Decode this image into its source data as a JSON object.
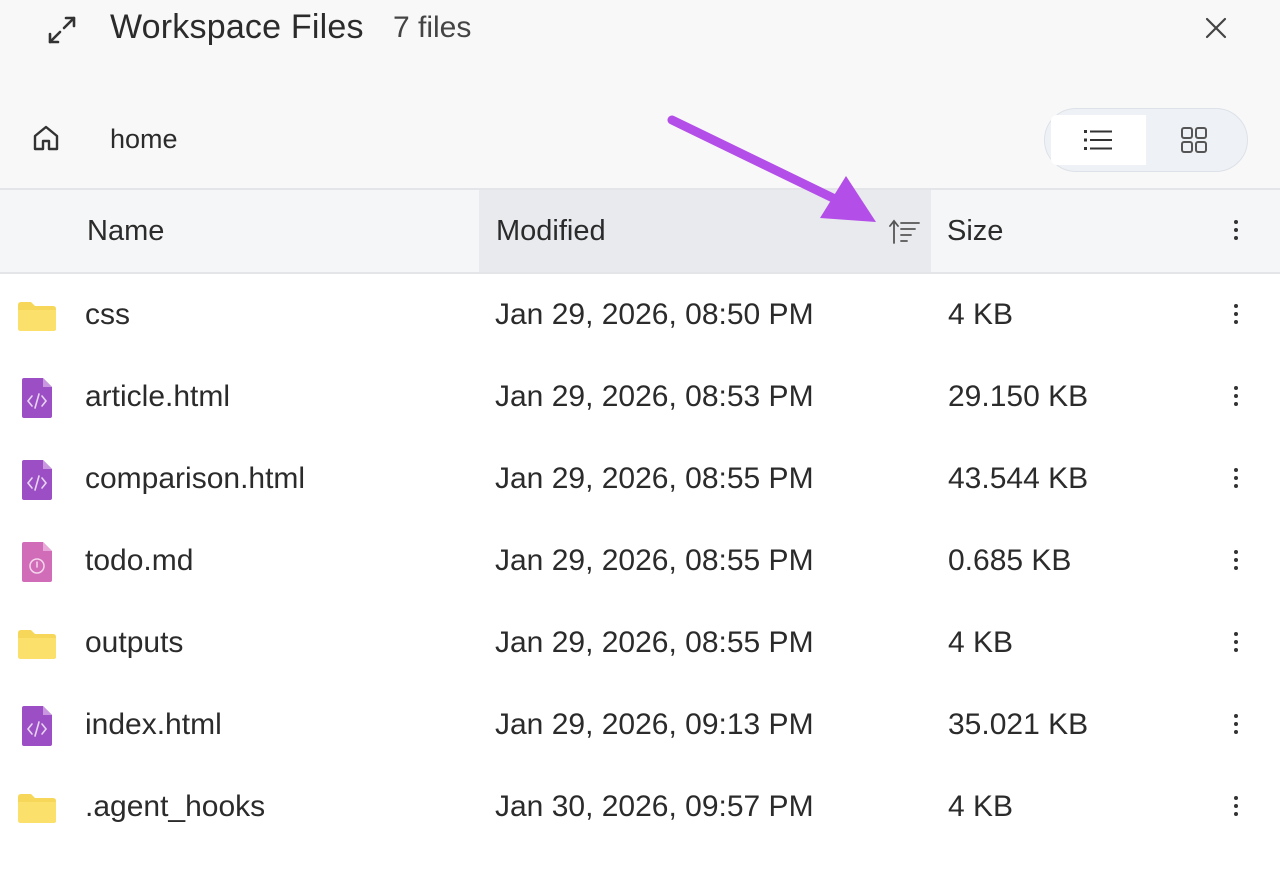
{
  "header": {
    "title": "Workspace Files",
    "count": "7 files"
  },
  "breadcrumb": {
    "current": "home"
  },
  "view_toggle": {
    "selected": "list"
  },
  "columns": {
    "name": "Name",
    "modified": "Modified",
    "size": "Size"
  },
  "sort": {
    "column": "Modified",
    "direction": "ascending"
  },
  "files": [
    {
      "name": "css",
      "type": "folder",
      "modified": "Jan 29, 2026, 08:50 PM",
      "size": "4 KB"
    },
    {
      "name": "article.html",
      "type": "html",
      "modified": "Jan 29, 2026, 08:53 PM",
      "size": "29.150 KB"
    },
    {
      "name": "comparison.html",
      "type": "html",
      "modified": "Jan 29, 2026, 08:55 PM",
      "size": "43.544 KB"
    },
    {
      "name": "todo.md",
      "type": "markdown",
      "modified": "Jan 29, 2026, 08:55 PM",
      "size": "0.685 KB"
    },
    {
      "name": "outputs",
      "type": "folder",
      "modified": "Jan 29, 2026, 08:55 PM",
      "size": "4 KB"
    },
    {
      "name": "index.html",
      "type": "html",
      "modified": "Jan 29, 2026, 09:13 PM",
      "size": "35.021 KB"
    },
    {
      "name": ".agent_hooks",
      "type": "folder",
      "modified": "Jan 30, 2026, 09:57 PM",
      "size": "4 KB"
    }
  ],
  "colors": {
    "folder": "#f7d75a",
    "html": "#9c4fc4",
    "markdown": "#d06cb8",
    "annotation_arrow": "#b44ee8"
  },
  "icons": {
    "expand": "expand-icon",
    "close": "close-icon",
    "home": "home-icon",
    "list_view": "list-view-icon",
    "grid_view": "grid-view-icon",
    "sort": "sort-ascending-icon",
    "more": "more-vertical-icon"
  }
}
